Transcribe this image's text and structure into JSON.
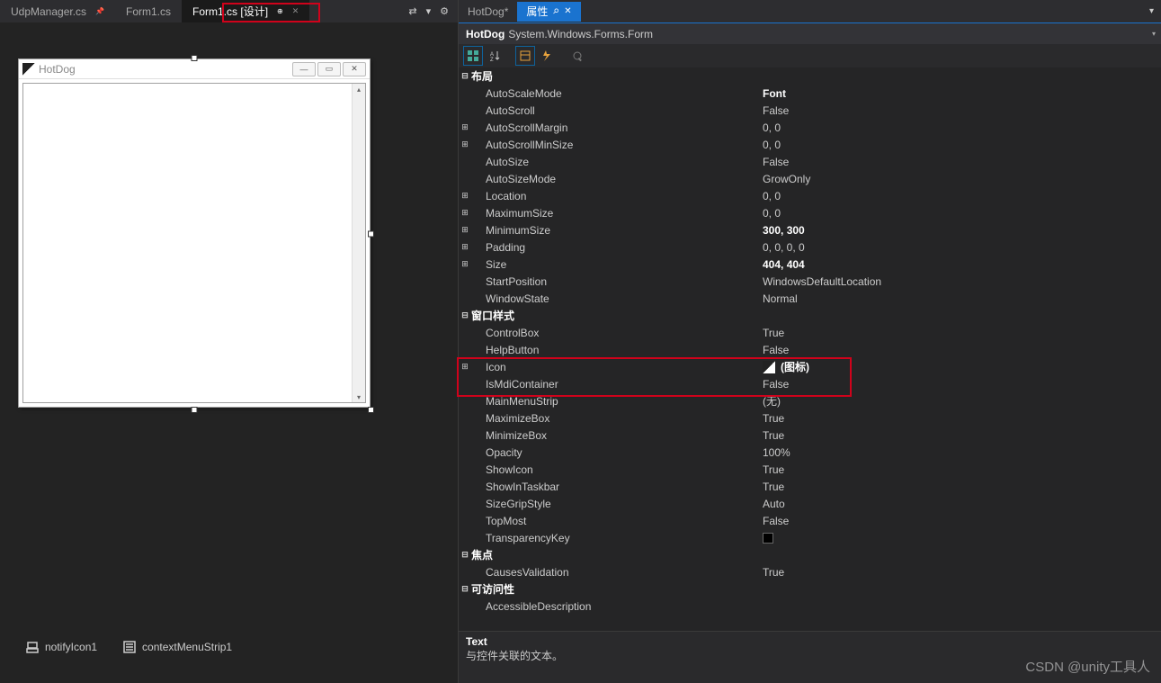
{
  "tabs": {
    "left": [
      {
        "label": "UdpManager.cs",
        "pinned": true,
        "active": false
      },
      {
        "label": "Form1.cs",
        "pinned": false,
        "active": false
      },
      {
        "label": "Form1.cs [设计]",
        "pinned": true,
        "active": true
      }
    ],
    "rightDoc": {
      "label": "HotDog*"
    },
    "rightProp": {
      "label": "属性"
    }
  },
  "designer": {
    "formTitle": "HotDog"
  },
  "tray": [
    {
      "icon": "notify-icon",
      "label": "notifyIcon1"
    },
    {
      "icon": "context-menu-icon",
      "label": "contextMenuStrip1"
    }
  ],
  "properties": {
    "objectName": "HotDog",
    "objectType": "System.Windows.Forms.Form",
    "categories": [
      {
        "name": "布局",
        "rows": [
          {
            "name": "AutoScaleMode",
            "value": "Font",
            "bold": true
          },
          {
            "name": "AutoScroll",
            "value": "False"
          },
          {
            "name": "AutoScrollMargin",
            "value": "0, 0",
            "expandable": true
          },
          {
            "name": "AutoScrollMinSize",
            "value": "0, 0",
            "expandable": true
          },
          {
            "name": "AutoSize",
            "value": "False"
          },
          {
            "name": "AutoSizeMode",
            "value": "GrowOnly"
          },
          {
            "name": "Location",
            "value": "0, 0",
            "expandable": true
          },
          {
            "name": "MaximumSize",
            "value": "0, 0",
            "expandable": true
          },
          {
            "name": "MinimumSize",
            "value": "300, 300",
            "bold": true,
            "expandable": true
          },
          {
            "name": "Padding",
            "value": "0, 0, 0, 0",
            "expandable": true
          },
          {
            "name": "Size",
            "value": "404, 404",
            "bold": true,
            "expandable": true
          },
          {
            "name": "StartPosition",
            "value": "WindowsDefaultLocation"
          },
          {
            "name": "WindowState",
            "value": "Normal"
          }
        ]
      },
      {
        "name": "窗口样式",
        "rows": [
          {
            "name": "ControlBox",
            "value": "True"
          },
          {
            "name": "HelpButton",
            "value": "False"
          },
          {
            "name": "Icon",
            "value": "(图标)",
            "expandable": true,
            "icon": true,
            "bold": true
          },
          {
            "name": "IsMdiContainer",
            "value": "False"
          },
          {
            "name": "MainMenuStrip",
            "value": "(无)"
          },
          {
            "name": "MaximizeBox",
            "value": "True"
          },
          {
            "name": "MinimizeBox",
            "value": "True"
          },
          {
            "name": "Opacity",
            "value": "100%"
          },
          {
            "name": "ShowIcon",
            "value": "True"
          },
          {
            "name": "ShowInTaskbar",
            "value": "True"
          },
          {
            "name": "SizeGripStyle",
            "value": "Auto"
          },
          {
            "name": "TopMost",
            "value": "False"
          },
          {
            "name": "TransparencyKey",
            "value": "",
            "swatch": true
          }
        ]
      },
      {
        "name": "焦点",
        "rows": [
          {
            "name": "CausesValidation",
            "value": "True"
          }
        ]
      },
      {
        "name": "可访问性",
        "rows": [
          {
            "name": "AccessibleDescription",
            "value": ""
          }
        ]
      }
    ],
    "description": {
      "title": "Text",
      "body": "与控件关联的文本。"
    }
  },
  "watermark": "CSDN @unity工具人"
}
